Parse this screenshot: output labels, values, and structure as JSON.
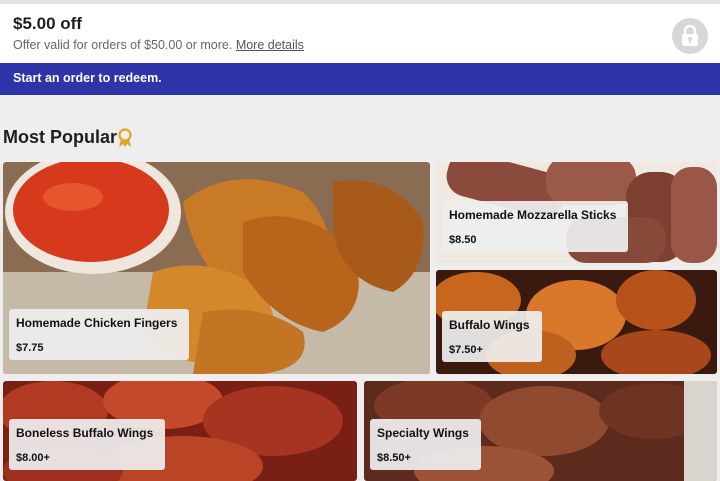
{
  "offer": {
    "title": "$5.00 off",
    "subtitle": "Offer valid for orders of $50.00 or more.",
    "details_link": "More details",
    "lock_icon": "lock-icon"
  },
  "redeem_bar": {
    "text": "Start an order to redeem."
  },
  "section": {
    "title": "Most Popular",
    "icon": "award-medal-icon"
  },
  "items": [
    {
      "name": "Homemade Chicken Fingers",
      "price": "$7.75"
    },
    {
      "name": "Homemade Mozzarella Sticks",
      "price": "$8.50"
    },
    {
      "name": "Buffalo Wings",
      "price": "$7.50+"
    },
    {
      "name": "Boneless Buffalo Wings",
      "price": "$8.00+"
    },
    {
      "name": "Specialty Wings",
      "price": "$8.50+"
    }
  ],
  "colors": {
    "accent_bar": "#2f35a8",
    "medal": "#e0a526"
  }
}
